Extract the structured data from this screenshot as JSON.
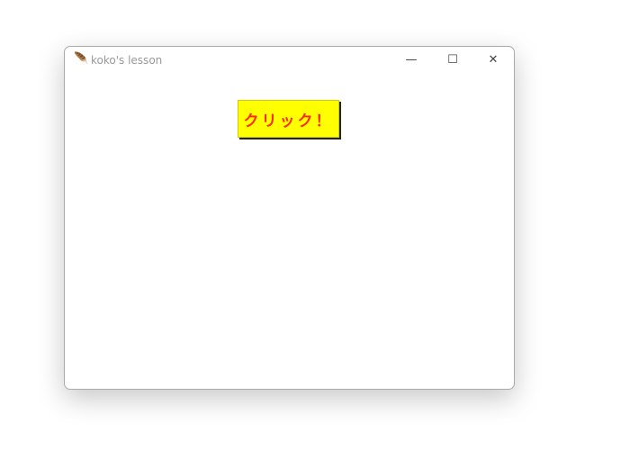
{
  "window": {
    "title": "koko's lesson",
    "icon": "feather-icon",
    "minimize": "—",
    "maximize": "☐",
    "close": "✕"
  },
  "button": {
    "label": "クリック！",
    "bg": "#ffff00",
    "fg": "#ff2a00"
  }
}
